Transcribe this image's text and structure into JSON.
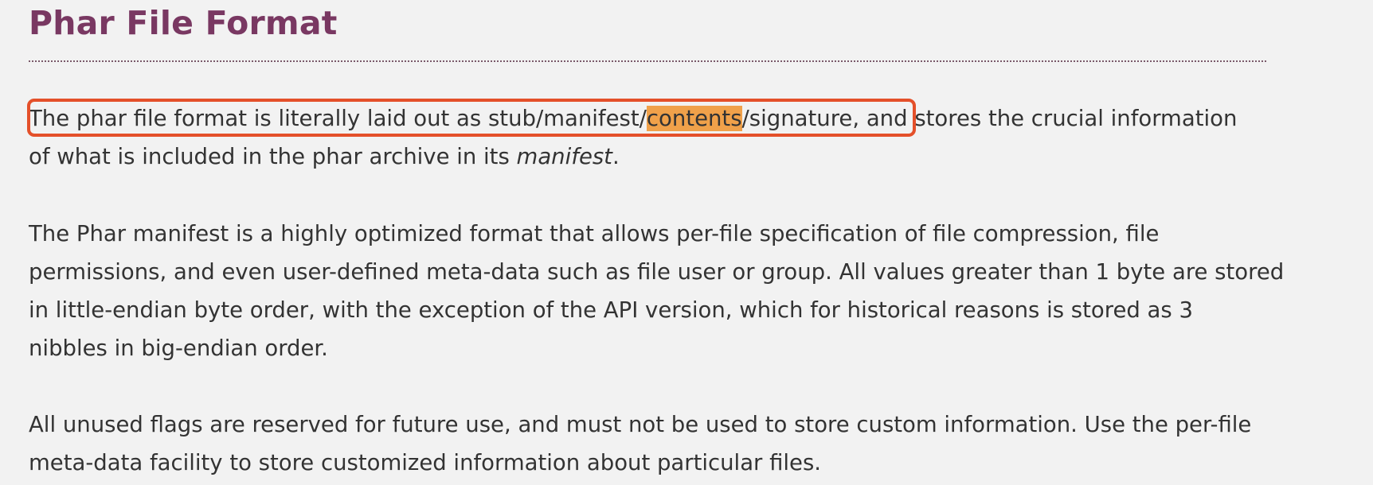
{
  "heading": "Phar File Format",
  "para1": {
    "line1_a": "The phar file format is literally laid out as stub/manifest/",
    "line1_highlight": "contents",
    "line1_b": "/signature,",
    "line1_c": " and stores the crucial information",
    "line2_a": "of what is included in the phar archive in its ",
    "line2_em": "manifest",
    "line2_b": "."
  },
  "para2": {
    "lines": [
      "The Phar manifest is a highly optimized format that allows per-file specification of file compression, file",
      "permissions, and even user-defined meta-data such as file user or group. All values greater than 1 byte are stored",
      "in little-endian byte order, with the exception of the API version, which for historical reasons is stored as 3",
      "nibbles in big-endian order."
    ]
  },
  "para3": {
    "lines": [
      "All unused flags are reserved for future use, and must not be used to store custom information. Use the per-file",
      "meta-data facility to store customized information about particular files."
    ]
  },
  "colors": {
    "heading": "#793862",
    "highlight": "#f0a14a",
    "callout_border": "#e4502a",
    "background": "#f2f2f2"
  }
}
